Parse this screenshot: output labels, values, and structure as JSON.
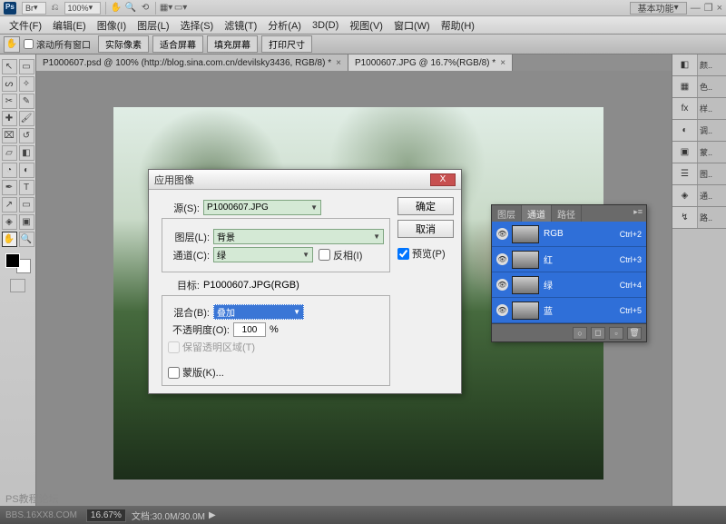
{
  "titlebar": {
    "br": "Br",
    "zoom": "100%",
    "workspace": "基本功能",
    "minimize": "—",
    "restore": "❐",
    "close": "×"
  },
  "menu": {
    "file": "文件(F)",
    "edit": "编辑(E)",
    "image": "图像(I)",
    "layer": "图层(L)",
    "select": "选择(S)",
    "filter": "滤镜(T)",
    "analysis": "分析(A)",
    "threed": "3D(D)",
    "view": "视图(V)",
    "window": "窗口(W)",
    "help": "帮助(H)"
  },
  "optbar": {
    "scrollall": "滚动所有窗口",
    "actual": "实际像素",
    "fitscreen": "适合屏幕",
    "fillscreen": "填充屏幕",
    "printsize": "打印尺寸"
  },
  "tabs": {
    "tab1": "P1000607.psd @ 100% (http://blog.sina.com.cn/devilsky3436, RGB/8) *",
    "tab2": "P1000607.JPG @ 16.7%(RGB/8) *"
  },
  "dialog": {
    "title": "应用图像",
    "source_lbl": "源(S):",
    "source_val": "P1000607.JPG",
    "layer_lbl": "图层(L):",
    "layer_val": "背景",
    "channel_lbl": "通道(C):",
    "channel_val": "绿",
    "invert_lbl": "反相(I)",
    "target_lbl": "目标:",
    "target_val": "P1000607.JPG(RGB)",
    "blend_lbl": "混合(B):",
    "blend_val": "叠加",
    "opacity_lbl": "不透明度(O):",
    "opacity_val": "100",
    "opacity_unit": "%",
    "preserve_lbl": "保留透明区域(T)",
    "mask_lbl": "蒙版(K)...",
    "ok": "确定",
    "cancel": "取消",
    "preview": "预览(P)"
  },
  "channels": {
    "tab_layers": "图层",
    "tab_channels": "通道",
    "tab_paths": "路径",
    "items": [
      {
        "name": "RGB",
        "short": "Ctrl+2"
      },
      {
        "name": "红",
        "short": "Ctrl+3"
      },
      {
        "name": "绿",
        "short": "Ctrl+4"
      },
      {
        "name": "蓝",
        "short": "Ctrl+5"
      }
    ]
  },
  "dock": {
    "l0": "颜..",
    "l1": "色..",
    "l2": "样..",
    "l3": "调..",
    "l4": "蒙..",
    "l5": "图..",
    "l6": "通..",
    "l7": "路.."
  },
  "status": {
    "forum": "PS教程论坛",
    "bbs": "BBS.16XX8.COM",
    "zoom_val": "16.67%",
    "docsize": "文档:30.0M/30.0M"
  }
}
